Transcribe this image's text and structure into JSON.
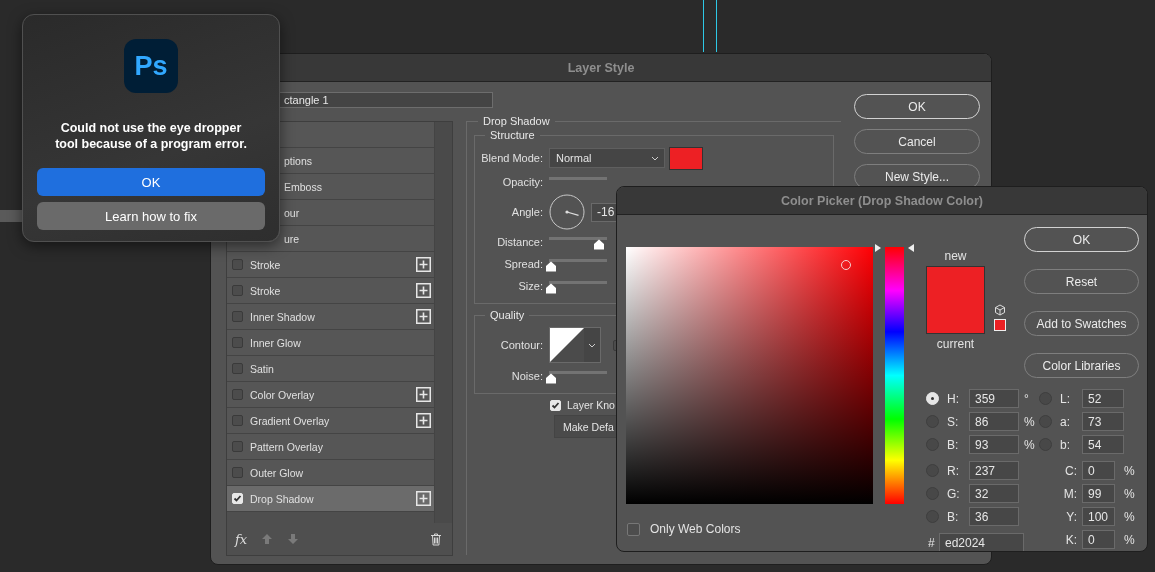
{
  "alert": {
    "icon_text": "Ps",
    "message": "Could not use the eye dropper tool because of a program error.",
    "buttons": [
      {
        "label": "OK",
        "primary": true
      },
      {
        "label": "Learn how to fix",
        "primary": false
      }
    ]
  },
  "layer_style": {
    "title": "Layer Style",
    "name_value": "ctangle 1",
    "styles": [
      {
        "kind": "covered"
      },
      {
        "kind": "covered",
        "label": "ptions"
      },
      {
        "kind": "covered",
        "label": "Emboss"
      },
      {
        "kind": "covered",
        "label": "our"
      },
      {
        "kind": "covered",
        "label": "ure"
      },
      {
        "kind": "style",
        "label": "Stroke",
        "checked": false,
        "selected": false,
        "add": true
      },
      {
        "kind": "style",
        "label": "Stroke",
        "checked": false,
        "selected": false,
        "add": true
      },
      {
        "kind": "style",
        "label": "Inner Shadow",
        "checked": false,
        "selected": false,
        "add": true
      },
      {
        "kind": "style",
        "label": "Inner Glow",
        "checked": false,
        "selected": false,
        "add": false
      },
      {
        "kind": "style",
        "label": "Satin",
        "checked": false,
        "selected": false,
        "add": false
      },
      {
        "kind": "style",
        "label": "Color Overlay",
        "checked": false,
        "selected": false,
        "add": true
      },
      {
        "kind": "style",
        "label": "Gradient Overlay",
        "checked": false,
        "selected": false,
        "add": true
      },
      {
        "kind": "style",
        "label": "Pattern Overlay",
        "checked": false,
        "selected": false,
        "add": false
      },
      {
        "kind": "style",
        "label": "Outer Glow",
        "checked": false,
        "selected": false,
        "add": false
      },
      {
        "kind": "style",
        "label": "Drop Shadow",
        "checked": true,
        "selected": true,
        "add": true
      }
    ],
    "fx_label": "fx",
    "group_title": "Drop Shadow",
    "structure": {
      "title": "Structure",
      "rows": [
        {
          "kind": "select",
          "label": "Blend Mode:",
          "value": "Normal"
        },
        {
          "kind": "slider",
          "label": "Opacity:"
        },
        {
          "kind": "angle",
          "label": "Angle:",
          "value": "-16"
        },
        {
          "kind": "slider",
          "label": "Distance:",
          "level": 0.95
        },
        {
          "kind": "slider",
          "label": "Spread:",
          "level": 0
        },
        {
          "kind": "slider",
          "label": "Size:",
          "level": 0
        }
      ]
    },
    "quality": {
      "title": "Quality",
      "rows": [
        {
          "kind": "contour",
          "label": "Contour:",
          "checked": false
        },
        {
          "kind": "slider",
          "label": "Noise:",
          "level": 0
        }
      ]
    },
    "knockout": {
      "label": "Layer Kno",
      "checked": true
    },
    "default_button": "Make Defa",
    "buttons": [
      {
        "label": "OK",
        "default": true
      },
      {
        "label": "Cancel",
        "default": false
      },
      {
        "label": "New Style...",
        "default": false
      }
    ]
  },
  "color_picker": {
    "title": "Color Picker (Drop Shadow Color)",
    "new_label": "new",
    "current_label": "current",
    "buttons": [
      {
        "label": "OK",
        "default": true
      },
      {
        "label": "Reset",
        "default": false
      },
      {
        "label": "Add to Swatches",
        "default": false
      },
      {
        "label": "Color Libraries",
        "default": false
      }
    ],
    "only_web_colors": {
      "label": "Only Web Colors",
      "checked": false
    },
    "hsb": [
      {
        "label": "H:",
        "value": "359",
        "unit": "°",
        "selected": true
      },
      {
        "label": "S:",
        "value": "86",
        "unit": "%",
        "selected": false
      },
      {
        "label": "B:",
        "value": "93",
        "unit": "%",
        "selected": false
      }
    ],
    "rgb": [
      {
        "label": "R:",
        "value": "237",
        "selected": false
      },
      {
        "label": "G:",
        "value": "32",
        "selected": false
      },
      {
        "label": "B:",
        "value": "36",
        "selected": false
      }
    ],
    "lab": [
      {
        "label": "L:",
        "value": "52",
        "selected": false
      },
      {
        "label": "a:",
        "value": "73",
        "selected": false
      },
      {
        "label": "b:",
        "value": "54",
        "selected": false
      }
    ],
    "cmyk": [
      {
        "label": "C:",
        "value": "0",
        "unit": "%"
      },
      {
        "label": "M:",
        "value": "99",
        "unit": "%"
      },
      {
        "label": "Y:",
        "value": "100",
        "unit": "%"
      },
      {
        "label": "K:",
        "value": "0",
        "unit": "%"
      }
    ],
    "hex": {
      "label": "#",
      "value": "ed2024"
    },
    "hue_slider": {
      "level": 0.997
    }
  }
}
